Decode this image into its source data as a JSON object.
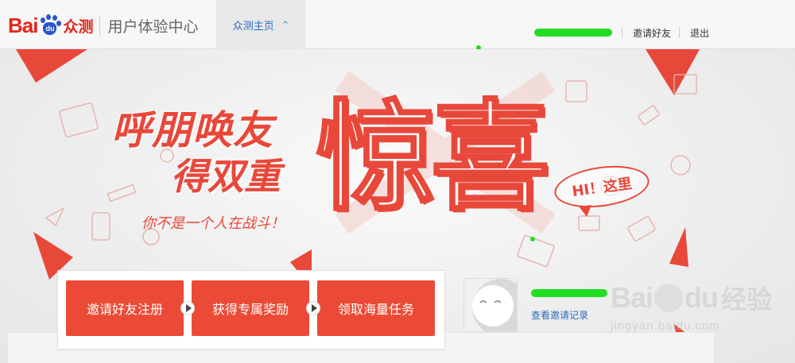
{
  "header": {
    "logo_bai": "Bai",
    "logo_du": "du",
    "logo_zhong": "众测",
    "logo_sub": "用户体验中心",
    "nav_tab_label": "众测主页",
    "nav_tab_chevron": "^",
    "invite_link": "邀请好友",
    "logout_link": "退出"
  },
  "banner": {
    "headline_line1": "呼朋唤友",
    "headline_line2": "得双重",
    "headline_big": "惊喜",
    "tagline": "你不是一个人在战斗！",
    "bubble_text": "HI！这里"
  },
  "steps": [
    {
      "label": "邀请好友注册"
    },
    {
      "label": "获得专属奖励"
    },
    {
      "label": "领取海量任务"
    }
  ],
  "invite_panel": {
    "view_records_link": "查看邀请记录"
  },
  "watermark": {
    "brand_bai": "Bai",
    "brand_du": "du",
    "brand_jy": "经验",
    "url": "jingyan.baidu.com"
  },
  "colors": {
    "accent_red": "#e8483a",
    "link_blue": "#2d6bbf",
    "redaction_green": "#22dd22"
  }
}
